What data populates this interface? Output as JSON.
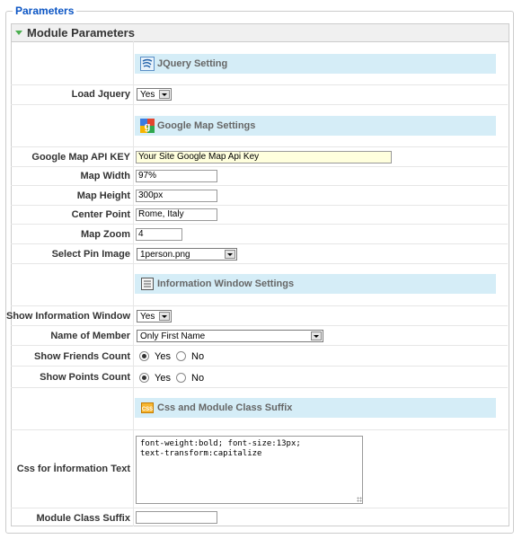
{
  "fieldset": {
    "legend": "Parameters"
  },
  "panel": {
    "title": "Module Parameters"
  },
  "sections": {
    "jquery": {
      "title": "JQuery Setting",
      "icon": "jquery-icon"
    },
    "google": {
      "title": "Google Map Settings",
      "icon": "google-icon"
    },
    "info": {
      "title": "Information Window Settings",
      "icon": "window-icon"
    },
    "css": {
      "title": "Css and Module Class Suffix",
      "icon": "css-icon"
    }
  },
  "fields": {
    "load_jquery": {
      "label": "Load Jquery",
      "value": "Yes"
    },
    "api_key": {
      "label": "Google Map API KEY",
      "value": "Your Site  Google Map Api Key"
    },
    "map_width": {
      "label": "Map Width",
      "value": "97%"
    },
    "map_height": {
      "label": "Map Height",
      "value": "300px"
    },
    "center_point": {
      "label": "Center Point",
      "value": "Rome, Italy"
    },
    "map_zoom": {
      "label": "Map Zoom",
      "value": "4"
    },
    "pin_image": {
      "label": "Select Pin Image",
      "value": "1person.png"
    },
    "show_info_window": {
      "label": "Show Information Window",
      "value": "Yes"
    },
    "member_name": {
      "label": "Name of Member",
      "value": "Only First Name"
    },
    "friends_count": {
      "label": "Show Friends Count",
      "yes": "Yes",
      "no": "No",
      "selected": "Yes"
    },
    "points_count": {
      "label": "Show Points Count",
      "yes": "Yes",
      "no": "No",
      "selected": "Yes"
    },
    "css_info": {
      "label": "Css for İnformation Text",
      "value": "font-weight:bold; font-size:13px;\ntext-transform:capitalize"
    },
    "class_suffix": {
      "label": "Module Class Suffix",
      "value": ""
    }
  },
  "colors": {
    "legend": "#0b55c4",
    "section_bg": "#d5edf7",
    "api_key_bg": "#ffffdd"
  }
}
